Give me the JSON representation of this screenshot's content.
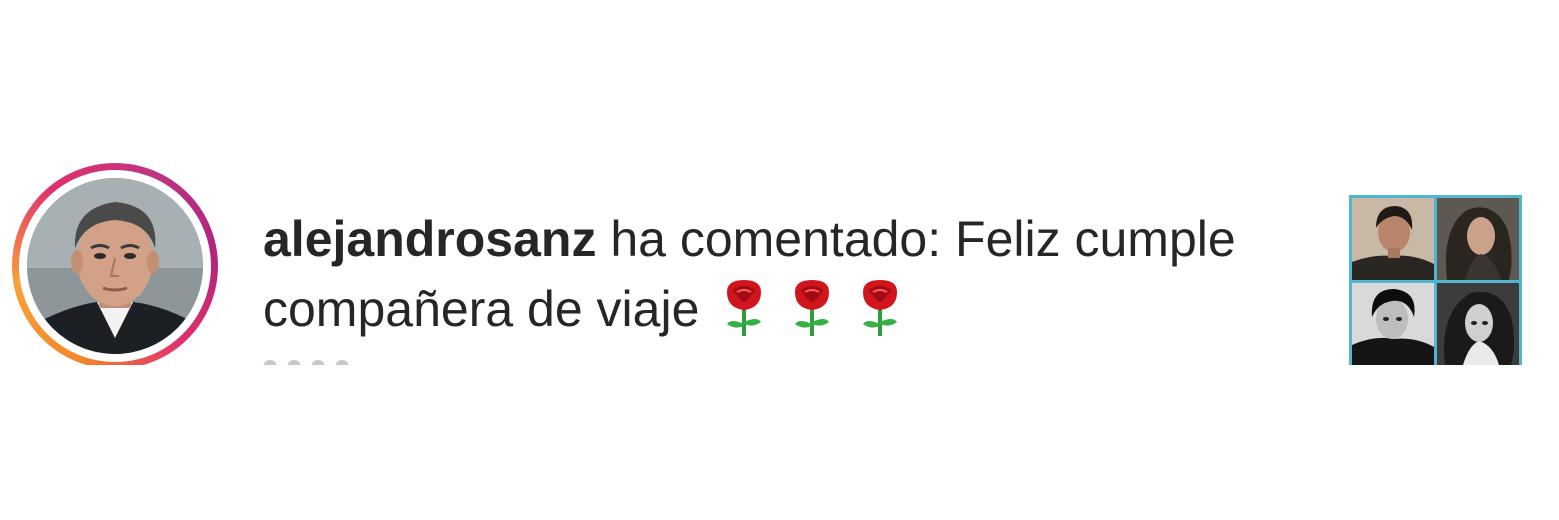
{
  "notification": {
    "username": "alejandrosanz",
    "message": " ha comentado: Feliz cumple compañera de viaje",
    "emoji": [
      "rose",
      "rose",
      "rose"
    ]
  },
  "avatar": {
    "ring_colors": [
      "#f58529",
      "#e1306c",
      "#c13584"
    ]
  },
  "thumbnail": {
    "border_color": "#4fb7cf"
  },
  "icons": {
    "rose": "rose-icon"
  }
}
